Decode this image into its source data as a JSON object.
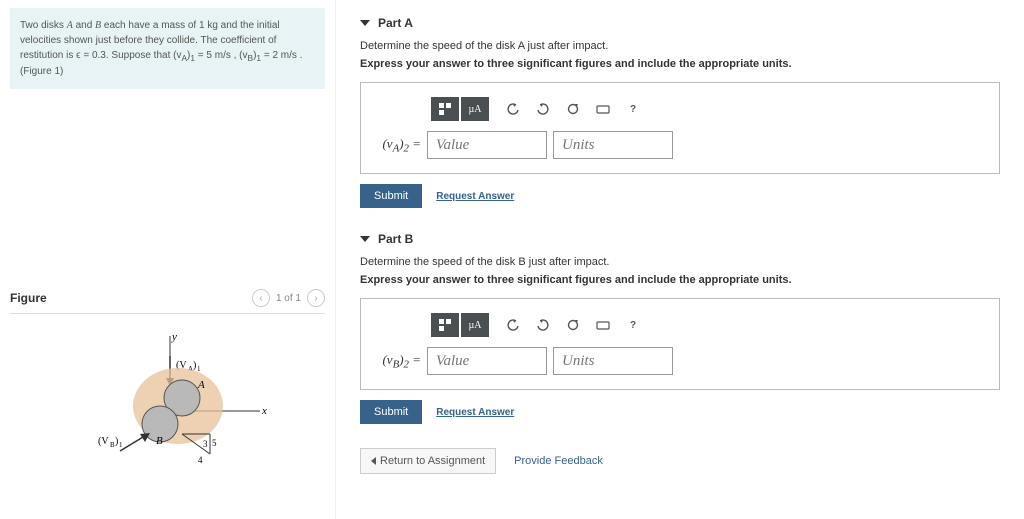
{
  "problem": {
    "text_html": "Two disks <span class='math'>A</span> and <span class='math'>B</span> each have a mass of 1 kg and the initial velocities shown just before they collide. The coefficient of restitution is ϵ = 0.3. Suppose that (v<sub>A</sub>)<sub>1</sub> = 5 m/s , (v<sub>B</sub>)<sub>1</sub> = 2 m/s . (Figure 1)"
  },
  "figure": {
    "title": "Figure",
    "nav_text": "1 of 1",
    "labels": {
      "y": "y",
      "x": "x",
      "A": "A",
      "B": "B",
      "vA": "(V_A)_1",
      "vB": "(V_B)_1",
      "angle_num": "3",
      "angle_den": "4",
      "angle_hyp": "5"
    }
  },
  "parts": [
    {
      "key": "A",
      "header": "Part A",
      "prompt_html": "Determine the speed of the disk <span class='math'>A</span> just after impact.",
      "instruction": "Express your answer to three significant figures and include the appropriate units.",
      "eq_label_html": "(v<sub>A</sub>)<sub>2</sub> =",
      "value_placeholder": "Value",
      "units_placeholder": "Units",
      "submit": "Submit",
      "request": "Request Answer"
    },
    {
      "key": "B",
      "header": "Part B",
      "prompt_html": "Determine the speed of the disk <span class='math'>B</span> just after impact.",
      "instruction": "Express your answer to three significant figures and include the appropriate units.",
      "eq_label_html": "(v<sub>B</sub>)<sub>2</sub> =",
      "value_placeholder": "Value",
      "units_placeholder": "Units",
      "submit": "Submit",
      "request": "Request Answer"
    }
  ],
  "toolbar": {
    "templates_icon": "templates-icon",
    "mu": "µA",
    "undo": "undo-icon",
    "redo": "redo-icon",
    "reset": "reset-icon",
    "keyboard": "keyboard-icon",
    "help": "?"
  },
  "footer": {
    "return": "Return to Assignment",
    "feedback": "Provide Feedback"
  }
}
